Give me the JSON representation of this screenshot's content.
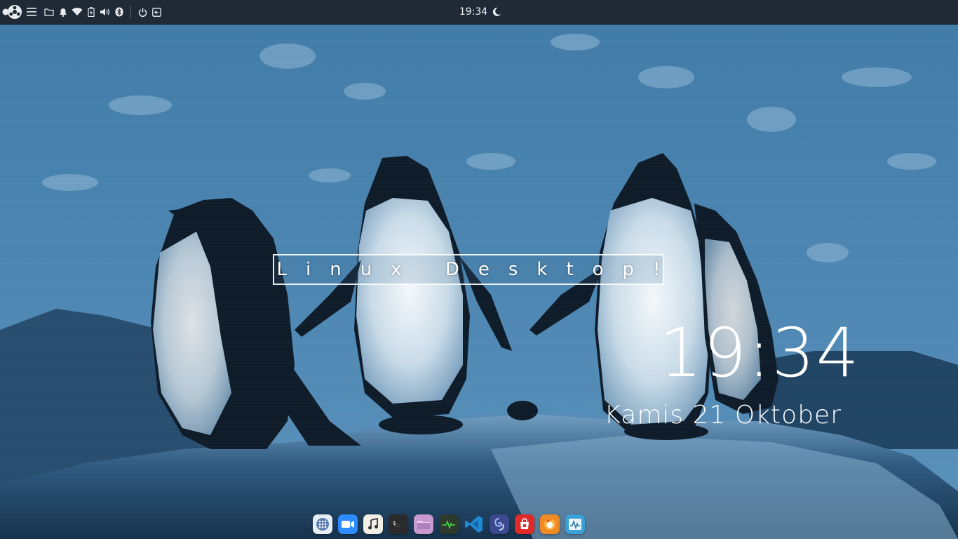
{
  "top_panel": {
    "clock": "19:34",
    "night_icon": "moon-icon",
    "tray_icons": [
      "workspace-dots-icon",
      "menu-icon",
      "folder-icon",
      "bell-icon",
      "wifi-icon",
      "battery-icon",
      "volume-icon",
      "bluetooth-icon",
      "power-icon",
      "logout-icon"
    ]
  },
  "desktop": {
    "title_text": "Linux Desktop!",
    "clock": "19:34",
    "date": "Kamis 21 Oktober"
  },
  "dock": {
    "apps": [
      {
        "name": "app-grid-icon",
        "color": "#e7eef6"
      },
      {
        "name": "zoom-icon",
        "color": "#2d8cff"
      },
      {
        "name": "music-icon",
        "color": "#f1eee6"
      },
      {
        "name": "terminal-icon",
        "color": "#2b2b2b"
      },
      {
        "name": "files-icon",
        "color": "#c79bcf"
      },
      {
        "name": "system-monitor-icon",
        "color": "#2f3a2f"
      },
      {
        "name": "vscode-icon",
        "color": "#1f8ad2"
      },
      {
        "name": "evolution-icon",
        "color": "#3b4a8c"
      },
      {
        "name": "software-store-icon",
        "color": "#e02a2a"
      },
      {
        "name": "firefox-icon",
        "color": "#f08a24"
      },
      {
        "name": "activity-monitor-icon",
        "color": "#3aa0d8"
      }
    ]
  },
  "colors": {
    "panel_bg": "#1f2a36",
    "sky": "#4a80ab",
    "rock": "#1b3550"
  }
}
